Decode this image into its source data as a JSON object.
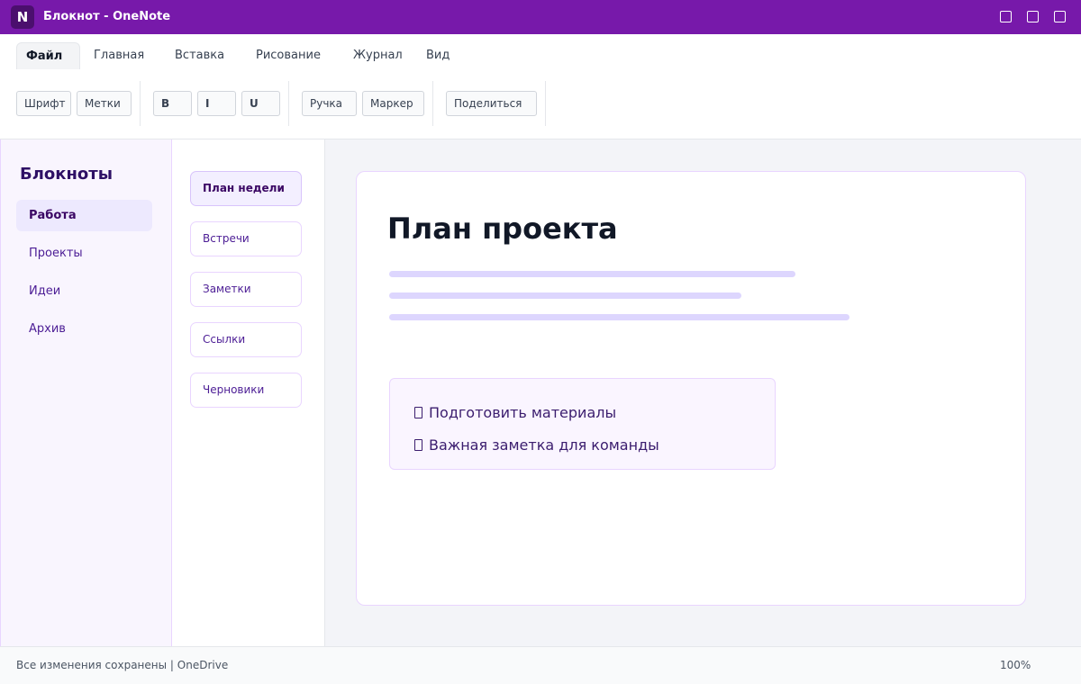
{
  "window": {
    "logo_letter": "N",
    "title": "Блокнот - OneNote"
  },
  "menu": {
    "tabs": [
      "Файл",
      "Главная",
      "Вставка",
      "Рисование",
      "Журнал",
      "Вид"
    ],
    "active_tab": "Файл"
  },
  "ribbon": {
    "font": "Шрифт",
    "tags": "Метки",
    "bold": "B",
    "italic": "I",
    "underline": "U",
    "pen": "Ручка",
    "highlighter": "Маркер",
    "share": "Поделиться"
  },
  "notebooks": {
    "heading": "Блокноты",
    "items": [
      "Работа",
      "Проекты",
      "Идеи",
      "Архив"
    ],
    "active": "Работа"
  },
  "pages": {
    "items": [
      "План недели",
      "Встречи",
      "Заметки",
      "Ссылки",
      "Черновики"
    ],
    "active": "План недели"
  },
  "note": {
    "title": "План проекта",
    "tasks": [
      "Подготовить материалы",
      "Важная заметка для команды"
    ]
  },
  "status": {
    "text": "Все изменения сохранены | OneDrive",
    "zoom": "100%"
  },
  "colors": {
    "accent": "#7719aa",
    "sidebar_bg": "#f9f5fe",
    "placeholder_line": "#ddd6fe"
  }
}
